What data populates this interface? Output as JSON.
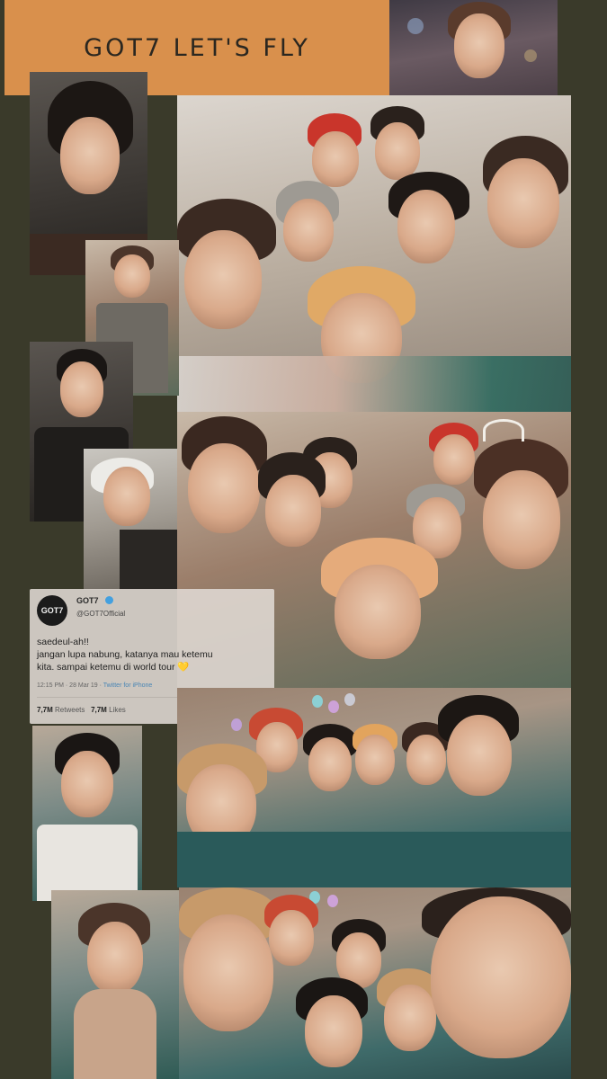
{
  "title": "GOT7 LET'S FLY",
  "tweet": {
    "avatar_label": "GOT7",
    "account_name": "GOT7",
    "handle": "@GOT7Official",
    "line1": "saedeul-ah!!",
    "line2": "jangan lupa nabung, katanya mau ketemu",
    "line3": "kita. sampai ketemu di world tour",
    "heart": "💛",
    "timestamp": "12:15 PM · 28 Mar 19 · ",
    "via": "Twitter for iPhone",
    "retweets_count": "7,7M",
    "retweets_label": "Retweets",
    "likes_count": "7,7M",
    "likes_label": "Likes"
  },
  "colors": {
    "background": "#3a3a2a",
    "title_box": "#d9904c",
    "title_text": "#2b2720"
  },
  "photos": [
    "portrait-top-right-stage",
    "portrait-left-dark",
    "group-selfie-1",
    "portrait-vest",
    "portrait-black-jacket",
    "portrait-white-hair",
    "group-selfie-2",
    "portrait-teal-blackhair",
    "group-party-teal-shirts",
    "portrait-scarf",
    "group-selfie-closeup"
  ]
}
